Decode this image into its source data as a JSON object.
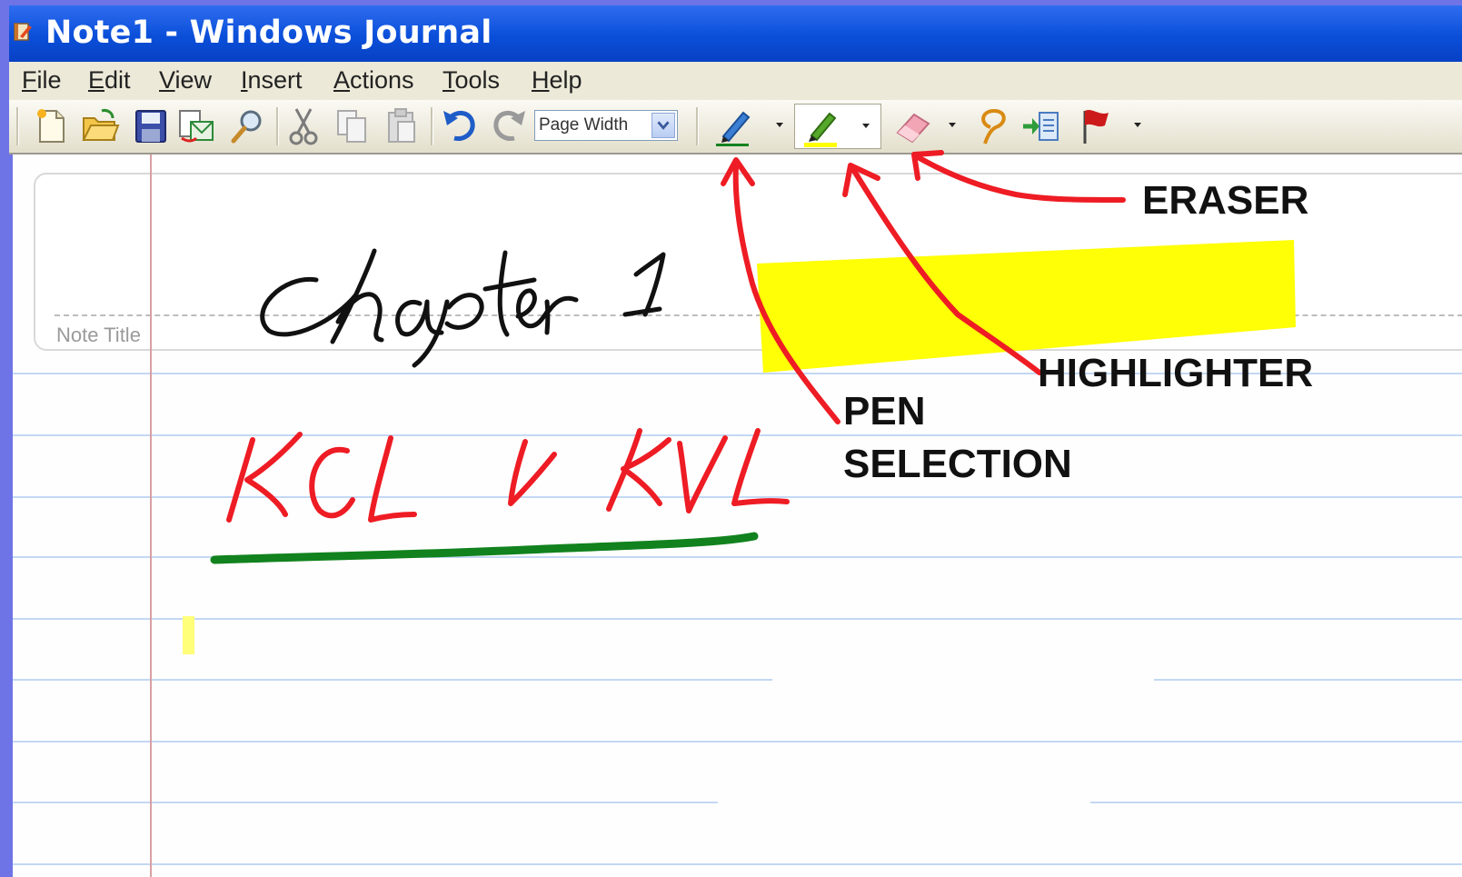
{
  "window": {
    "title": "Note1 - Windows Journal"
  },
  "menu": [
    {
      "id": "file",
      "pre": "",
      "u": "F",
      "post": "ile"
    },
    {
      "id": "edit",
      "pre": "",
      "u": "E",
      "post": "dit"
    },
    {
      "id": "view",
      "pre": "",
      "u": "V",
      "post": "iew"
    },
    {
      "id": "insert",
      "pre": "",
      "u": "I",
      "post": "nsert"
    },
    {
      "id": "actions",
      "pre": "",
      "u": "A",
      "post": "ctions"
    },
    {
      "id": "tools",
      "pre": "",
      "u": "T",
      "post": "ools"
    },
    {
      "id": "help",
      "pre": "",
      "u": "H",
      "post": "elp"
    }
  ],
  "toolbar": {
    "zoom_value": "Page Width",
    "icons": [
      "new-note-icon",
      "open-folder-icon",
      "save-icon",
      "send-email-icon",
      "find-icon",
      "cut-icon",
      "copy-icon",
      "paste-icon",
      "undo-icon",
      "redo-icon",
      "pen-icon",
      "highlighter-icon",
      "eraser-icon",
      "lasso-select-icon",
      "insert-space-icon",
      "flag-icon"
    ]
  },
  "page": {
    "title_placeholder": "Note Title",
    "handwriting": [
      "chapter 1",
      "KCL & KVL"
    ]
  },
  "annotations": {
    "eraser": "ERASER",
    "highlighter": "HIGHLIGHTER",
    "pen_line1": "PEN",
    "pen_line2": "SELECTION"
  },
  "colors": {
    "title_bar": "#0a4fd9",
    "highlighter_ink": "#ffff00",
    "pen_red_ink": "#ee1c24",
    "pen_green_ink": "#11821e",
    "page_rule": "#c3d8f4",
    "margin_rule": "#d9a0a4"
  }
}
